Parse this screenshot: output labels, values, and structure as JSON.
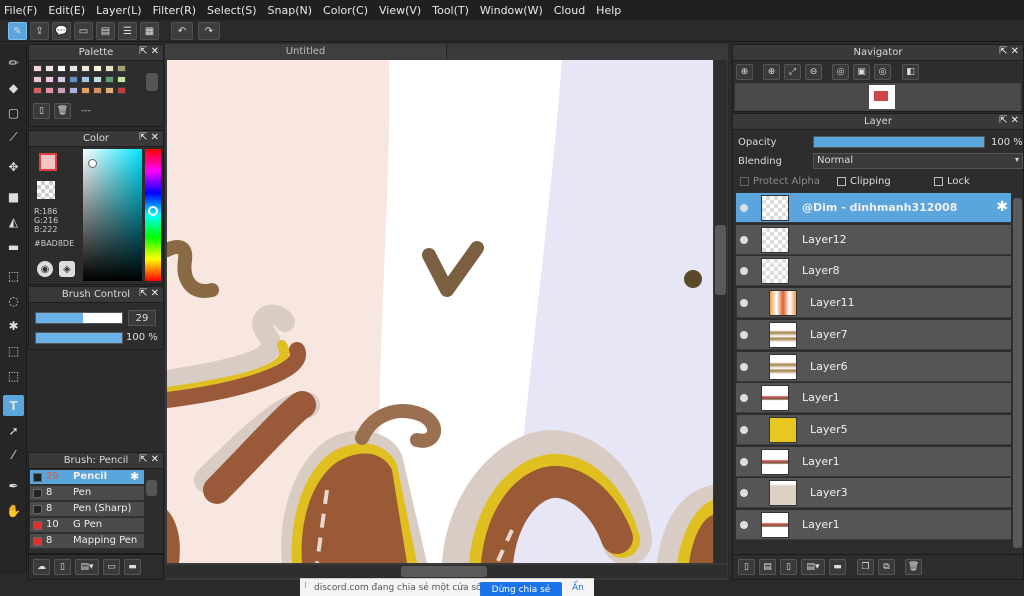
{
  "menu": [
    "File(F)",
    "Edit(E)",
    "Layer(L)",
    "Filter(R)",
    "Select(S)",
    "Snap(N)",
    "Color(C)",
    "View(V)",
    "Tool(T)",
    "Window(W)",
    "Cloud",
    "Help"
  ],
  "canvas": {
    "tab_title": "Untitled"
  },
  "palette": {
    "title": "Palette",
    "footer_text": "---"
  },
  "color": {
    "title": "Color",
    "r": "R:186",
    "g": "G:216",
    "b": "B:222",
    "hex": "#BAD8DE",
    "fg_color": "#f0c4c4",
    "accent": "#5aa6dc"
  },
  "brush_control": {
    "title": "Brush Control",
    "size": "29",
    "opacity": "100 %"
  },
  "brush_panel": {
    "title": "Brush: Pencil",
    "items": [
      {
        "size": "29",
        "name": "Pencil",
        "color": "#222222",
        "selected": true
      },
      {
        "size": "8",
        "name": "Pen",
        "color": "#222222"
      },
      {
        "size": "8",
        "name": "Pen (Sharp)",
        "color": "#222222"
      },
      {
        "size": "10",
        "name": "G Pen",
        "color": "#e03030"
      },
      {
        "size": "8",
        "name": "Mapping Pen",
        "color": "#e03030"
      }
    ]
  },
  "navigator": {
    "title": "Navigator"
  },
  "layer_panel": {
    "title": "Layer",
    "opacity_label": "Opacity",
    "opacity_value": "100 %",
    "opacity_fraction": 1.0,
    "blending_label": "Blending",
    "blending_value": "Normal",
    "protect_alpha": "Protect Alpha",
    "clipping": "Clipping",
    "lock": "Lock"
  },
  "layers": [
    {
      "name": "@Dim - dinhmanh312008",
      "selected": true,
      "indent": false,
      "thumb": "blank"
    },
    {
      "name": "Layer12",
      "indent": false,
      "thumb": "blank"
    },
    {
      "name": "Layer8",
      "indent": false,
      "thumb": "blank"
    },
    {
      "name": "Layer11",
      "indent": true,
      "thumb": "orange"
    },
    {
      "name": "Layer7",
      "indent": true,
      "thumb": "wave"
    },
    {
      "name": "Layer6",
      "indent": true,
      "thumb": "wave"
    },
    {
      "name": "Layer1",
      "indent": false,
      "thumb": "text"
    },
    {
      "name": "Layer5",
      "indent": true,
      "thumb": "yellow"
    },
    {
      "name": "Layer1",
      "indent": false,
      "thumb": "text"
    },
    {
      "name": "Layer3",
      "indent": true,
      "thumb": "beige"
    },
    {
      "name": "Layer1",
      "indent": false,
      "thumb": "text"
    }
  ],
  "notification": {
    "message": "discord.com đang chia sẻ một cửa sổ.",
    "stop_button": "Dừng chia sẻ",
    "hide_link": "Ẩn"
  }
}
